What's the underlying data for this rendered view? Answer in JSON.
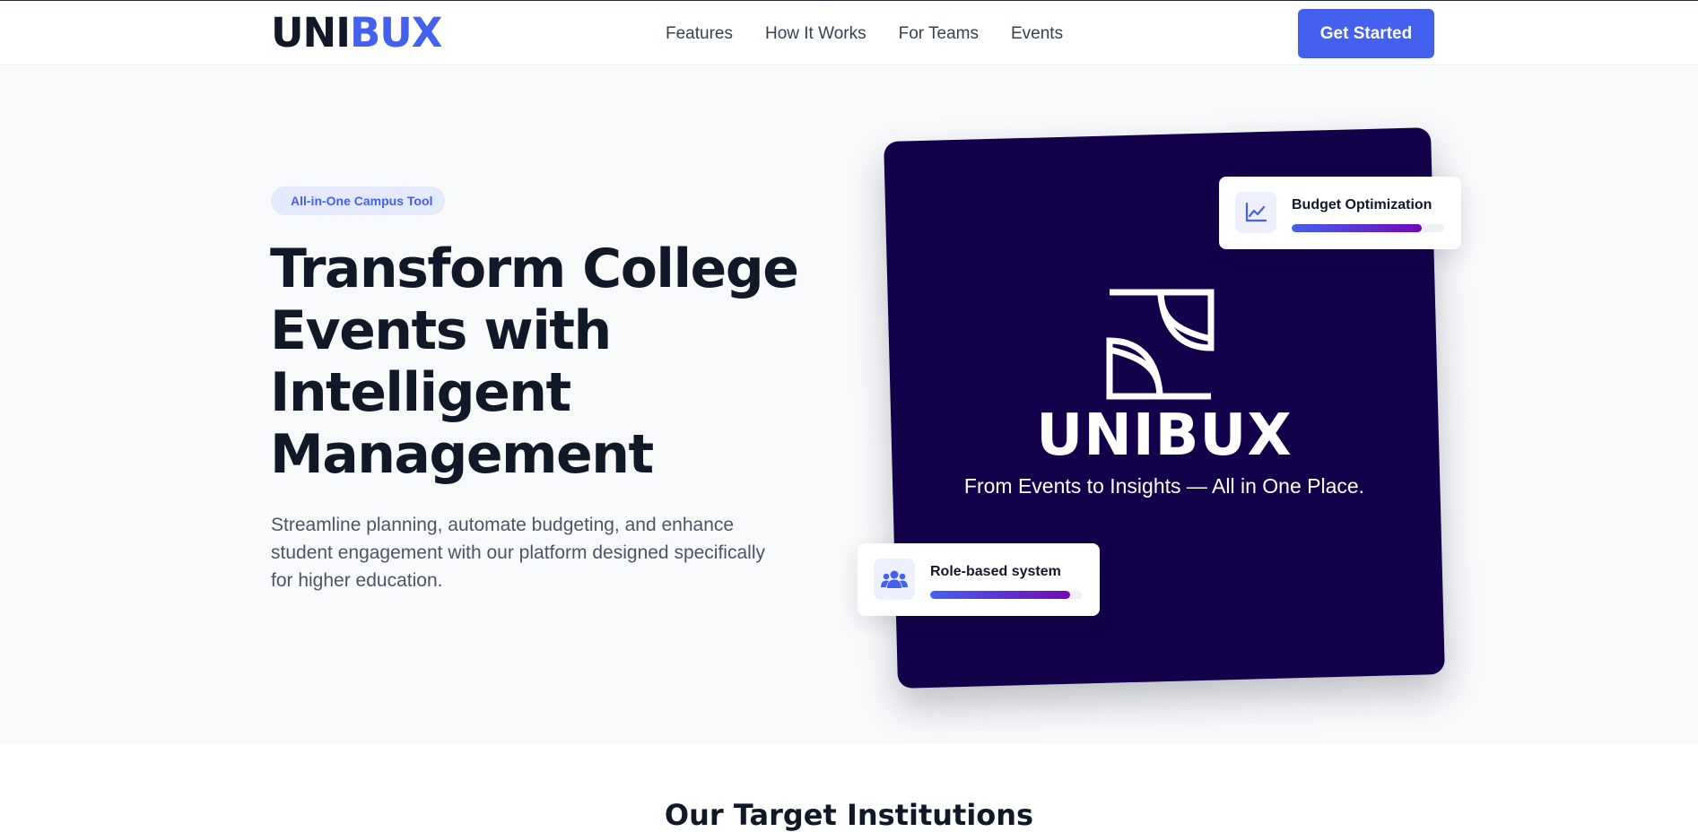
{
  "header": {
    "logo_part1": "UNI",
    "logo_part2": "BUX",
    "nav": [
      "Features",
      "How It Works",
      "For Teams",
      "Events"
    ],
    "cta_label": "Get Started"
  },
  "hero": {
    "badge": "All-in-One Campus Tool",
    "headline": [
      "Transform College",
      "Events with",
      "Intelligent",
      "Management"
    ],
    "subtitle": "Streamline planning, automate budgeting, and enhance student engagement with our platform designed specifically for higher education.",
    "visual": {
      "brand_name": "UNIBUX",
      "brand_tagline": "From Events to Insights — All in One Place.",
      "cards": [
        {
          "label": "Budget Optimization",
          "icon": "chart-line-icon",
          "progress": 0.85
        },
        {
          "label": "Role-based system",
          "icon": "users-icon",
          "progress": 0.92
        }
      ]
    }
  },
  "next_section": {
    "title": "Our Target Institutions"
  },
  "colors": {
    "accent": "#4361ee",
    "purple": "#7209b7",
    "card_bg": "#12004a",
    "text_dark": "#111827",
    "text_muted": "#4b5563"
  }
}
